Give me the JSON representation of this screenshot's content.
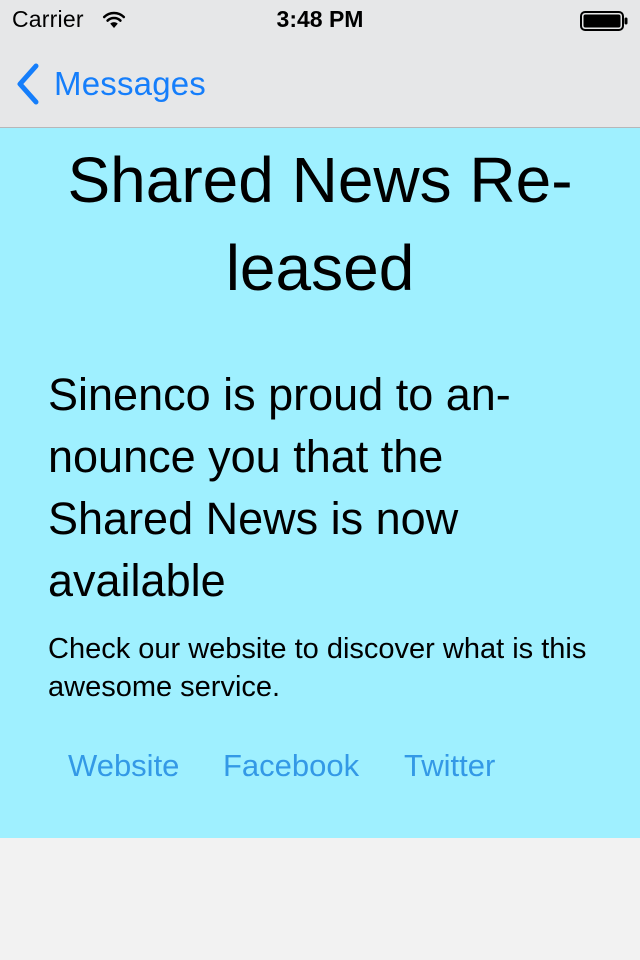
{
  "status_bar": {
    "carrier": "Carrier",
    "time": "3:48 PM",
    "wifi_icon": "wifi-icon",
    "battery_icon": "battery-icon"
  },
  "nav": {
    "back_label": "Messages",
    "back_icon": "chevron-left-icon",
    "tint_color": "#157efb"
  },
  "message": {
    "background_color": "#9ff0ff",
    "headline": "Shared News Re-leased",
    "subhead": "Sinenco is proud to an-nounce you that the Shared News is now available",
    "body": "Check our website to discover what is this awesome service.",
    "links": [
      {
        "label": "Website"
      },
      {
        "label": "Facebook"
      },
      {
        "label": "Twitter"
      }
    ],
    "link_color": "#3399e6"
  }
}
